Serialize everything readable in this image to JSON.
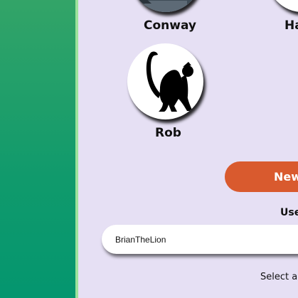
{
  "avatars": [
    {
      "name": "Conway",
      "icon": "conway-avatar-icon"
    },
    {
      "name": "Ha",
      "icon": "partial-avatar-icon"
    },
    {
      "name": "Rob",
      "icon": "monkey-icon"
    }
  ],
  "new_button_label": "New",
  "username": {
    "label": "Use",
    "value": "BrianTheLion"
  },
  "select_hint": "Select a",
  "colors": {
    "background": "#e6e0f4",
    "sidebar_top": "#33a468",
    "sidebar_bottom": "#04966f",
    "sidebar_stripe": "#9de29c",
    "new_button": "#d95a2e"
  }
}
